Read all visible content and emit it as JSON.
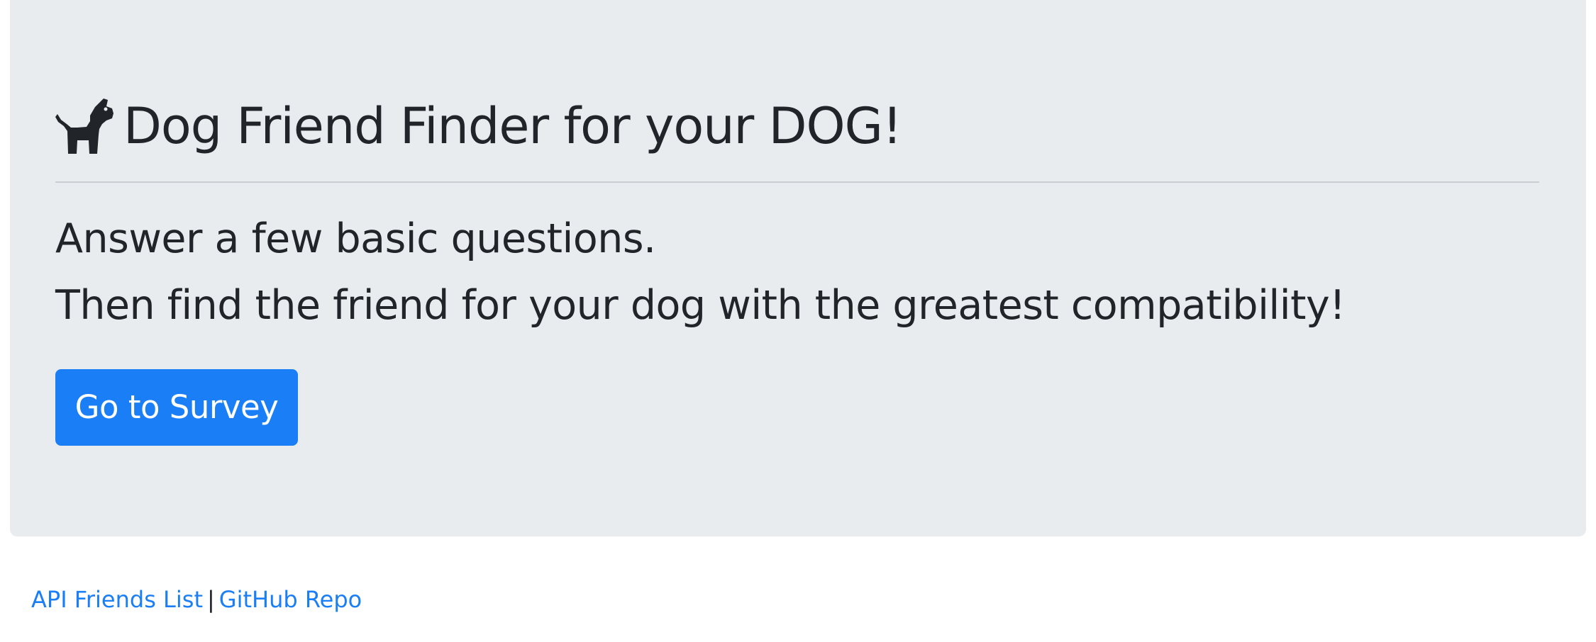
{
  "hero": {
    "title": "Dog Friend Finder for your DOG!",
    "icon": "dog-icon",
    "lines": [
      "Answer a few basic questions.",
      "Then find the friend for your dog with the greatest compatibility!"
    ],
    "button_label": "Go to Survey"
  },
  "footer": {
    "links": [
      "API Friends List",
      "GitHub Repo"
    ],
    "separator": "|"
  },
  "colors": {
    "hero_background": "#e9ecef",
    "primary": "#1a7ef7",
    "text": "#212529"
  }
}
